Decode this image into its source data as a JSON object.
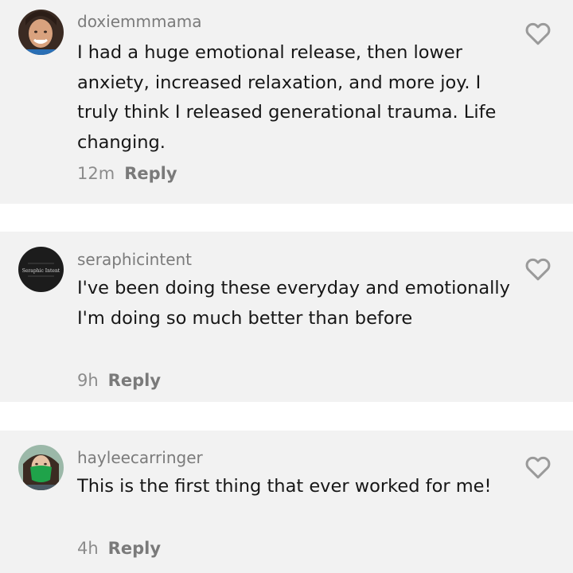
{
  "comments": [
    {
      "username": "doxiemmmama",
      "text": "I had a huge emotional release, then lower anxiety, increased relaxation, and more joy. I truly think I released generational trauma. Life changing.",
      "time": "12m",
      "reply_label": "Reply",
      "avatar_icon": "user-photo-avatar",
      "like_icon": "heart-outline-icon"
    },
    {
      "username": "seraphicintent",
      "text": "I've been doing these everyday and emotionally I'm doing so much better than before",
      "time": "9h",
      "reply_label": "Reply",
      "avatar_icon": "seraphic-intent-logo-avatar",
      "avatar_logo_text": "Seraphic Intent",
      "like_icon": "heart-outline-icon"
    },
    {
      "username": "hayleecarringer",
      "text": "This is the first thing that ever worked for me!",
      "time": "4h",
      "reply_label": "Reply",
      "avatar_icon": "user-photo-avatar",
      "like_icon": "heart-outline-icon"
    }
  ],
  "colors": {
    "card_background": "#f2f2f2",
    "separator": "#ffffff",
    "username": "#7b7b7b",
    "comment_text": "#161616",
    "meta_text": "#8c8c8c"
  }
}
